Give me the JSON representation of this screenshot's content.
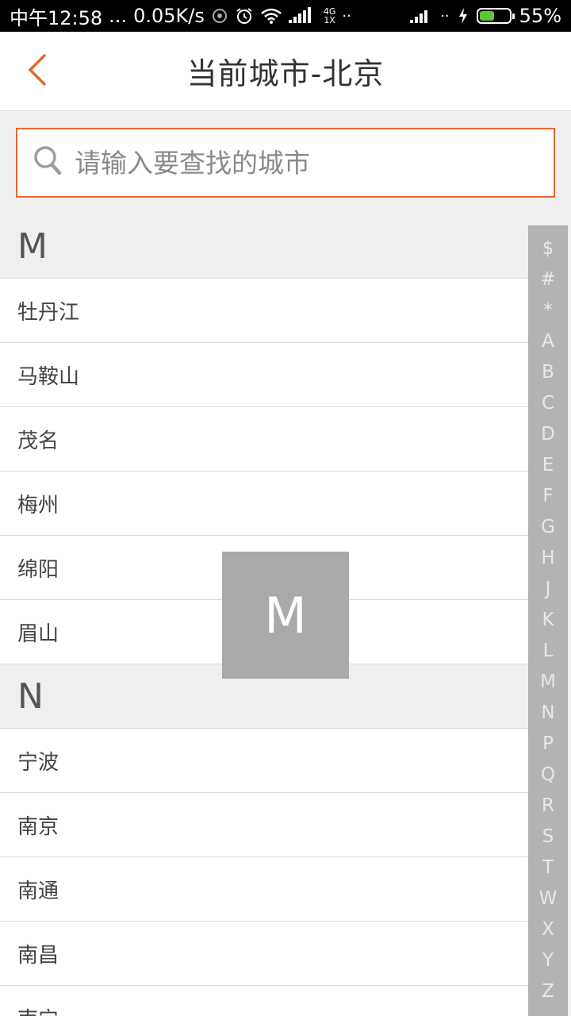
{
  "status_bar": {
    "time": "中午12:58",
    "dots": "...",
    "speed": "0.05K/s",
    "network_top": "4G",
    "network_bottom": "1X",
    "battery": "55%",
    "battery_level": 0.55,
    "battery_color": "#5ec536"
  },
  "header": {
    "title": "当前城市-北京",
    "back_icon": "chevron-left-icon",
    "accent": "#e36a2c"
  },
  "search": {
    "placeholder": "请输入要查找的城市",
    "value": "",
    "icon": "search-icon"
  },
  "sections": [
    {
      "letter": "M",
      "cities": [
        "牡丹江",
        "马鞍山",
        "茂名",
        "梅州",
        "绵阳",
        "眉山"
      ]
    },
    {
      "letter": "N",
      "cities": [
        "宁波",
        "南京",
        "南通",
        "南昌",
        "南宁"
      ]
    }
  ],
  "index_letters": [
    "$",
    "#",
    "*",
    "A",
    "B",
    "C",
    "D",
    "E",
    "F",
    "G",
    "H",
    "J",
    "K",
    "L",
    "M",
    "N",
    "P",
    "Q",
    "R",
    "S",
    "T",
    "W",
    "X",
    "Y",
    "Z"
  ],
  "overlay_letter": "M"
}
